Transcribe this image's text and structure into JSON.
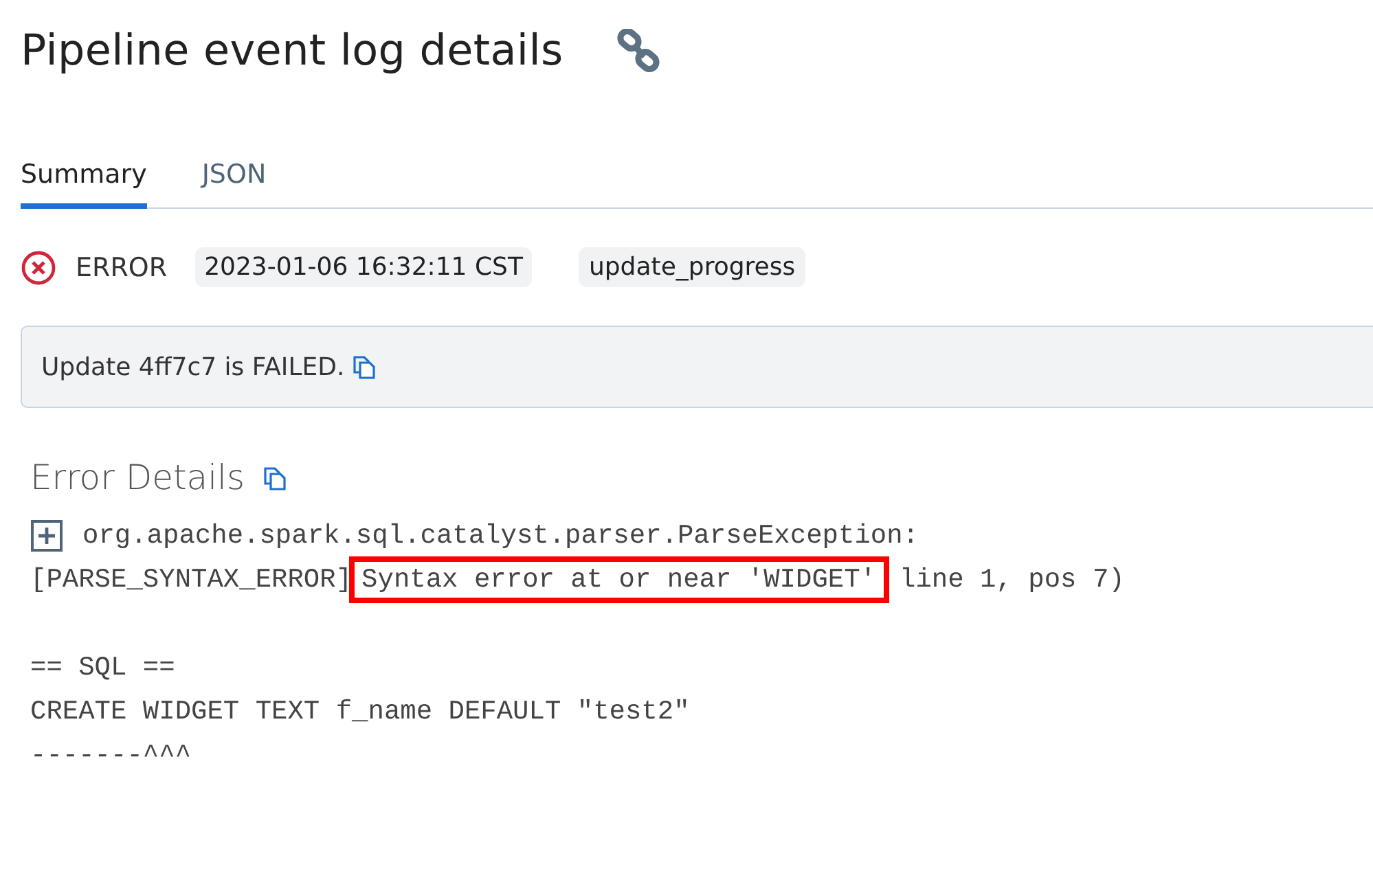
{
  "title": "Pipeline event log details",
  "tabs": [
    {
      "label": "Summary",
      "selected": true
    },
    {
      "label": "JSON",
      "selected": false
    }
  ],
  "event": {
    "level": "ERROR",
    "timestamp": "2023-01-06 16:32:11 CST",
    "event_type": "update_progress"
  },
  "message": "Update 4ff7c7 is FAILED.",
  "error_details": {
    "title": "Error Details",
    "expanded": false,
    "lines": [
      [
        {
          "text": "org.apache.spark.sql.catalyst.parser.ParseException:",
          "highlighted": false
        }
      ],
      [
        {
          "text": "[PARSE_SYNTAX_ERROR]",
          "highlighted": false
        },
        {
          "text": "Syntax error at or near 'WIDGET'",
          "highlighted": true
        },
        {
          "text": "line 1, pos 7)",
          "highlighted": false
        }
      ],
      {
        "kind": "blank"
      },
      [
        {
          "text": "== SQL ==",
          "highlighted": false
        }
      ],
      [
        {
          "text": "CREATE WIDGET TEXT f_name DEFAULT \"test2\"",
          "highlighted": false
        }
      ],
      [
        {
          "text": "-------^^^",
          "highlighted": false
        }
      ]
    ]
  }
}
